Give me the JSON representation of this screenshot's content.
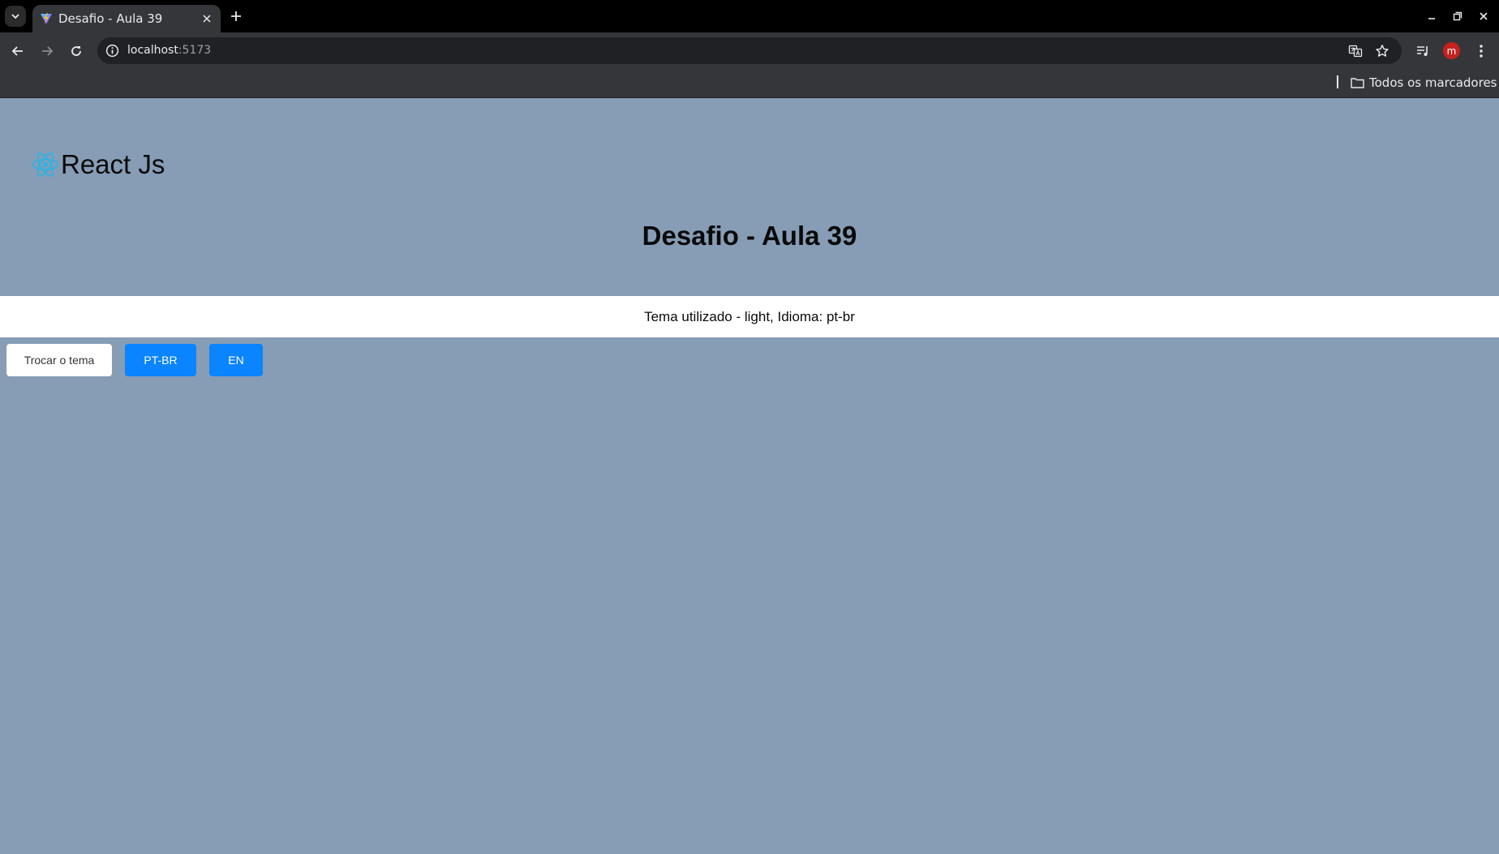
{
  "browser": {
    "tab": {
      "title": "Desafio - Aula 39"
    },
    "address": {
      "host": "localhost",
      "port": ":5173"
    },
    "bookmarks": {
      "all_label": "Todos os marcadores"
    },
    "profile_initial": "m"
  },
  "page": {
    "brand": "React Js",
    "title": "Desafio - Aula 39",
    "status": "Tema utilizado - light, Idioma: pt-br",
    "buttons": {
      "theme": "Trocar o tema",
      "ptbr": "PT-BR",
      "en": "EN"
    }
  },
  "colors": {
    "page_background": "#869db5",
    "button_primary": "#0a84ff",
    "react_logo": "#2bb3e6"
  },
  "icons": [
    "tab-list-icon",
    "vite-favicon-icon",
    "close-icon",
    "plus-icon",
    "minimize-icon",
    "restore-icon",
    "window-close-icon",
    "back-arrow-icon",
    "forward-arrow-icon",
    "reload-icon",
    "info-icon",
    "translate-icon",
    "star-icon",
    "media-controls-icon",
    "menu-dots-icon",
    "folder-icon",
    "react-logo-icon"
  ]
}
